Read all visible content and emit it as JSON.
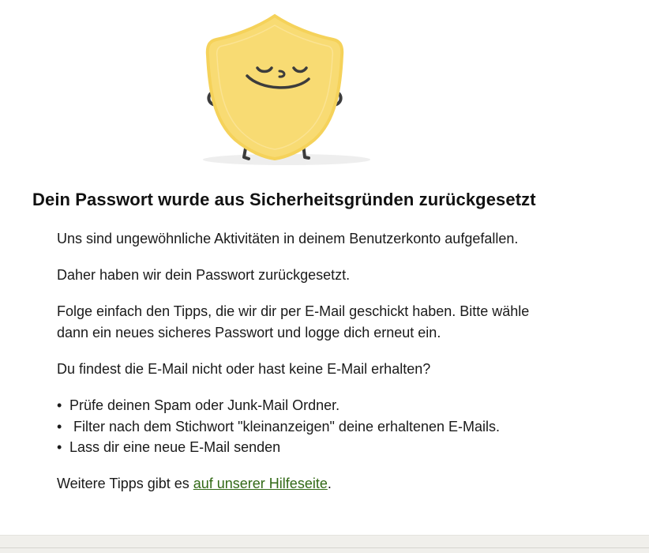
{
  "title": "Dein Passwort wurde aus Sicherheitsgründen zurückgesetzt",
  "paragraphs": {
    "p1": "Uns sind ungewöhnliche Aktivitäten in deinem Benutzerkonto aufgefallen.",
    "p2": "Daher haben wir dein Passwort zurückgesetzt.",
    "p3": "Folge einfach den Tipps, die wir dir per E-Mail geschickt haben. Bitte wähle dann ein neues sicheres Passwort und logge dich erneut ein.",
    "p4": "Du findest die E-Mail nicht oder hast keine E-Mail erhalten?"
  },
  "tips": [
    {
      "bullet": "•",
      "text": "Prüfe deinen Spam oder Junk-Mail Ordner."
    },
    {
      "bullet": "•",
      "text": " Filter nach dem Stichwort \"kleinanzeigen\" deine erhaltenen E-Mails."
    },
    {
      "bullet": "•",
      "text": "Lass dir eine neue E-Mail senden"
    }
  ],
  "help": {
    "prefix": "Weitere Tipps gibt es ",
    "link_text": "auf unserer Hilfeseite",
    "suffix": "."
  },
  "illustration": {
    "icon": "shield-mascot-icon",
    "shield_color": "#f8db73",
    "shield_border_color": "#f5d25a",
    "face_color": "#3c3c3c",
    "shadow_color": "#eeeeee"
  },
  "colors": {
    "link": "#326916",
    "footer_background": "#f0efeb"
  }
}
